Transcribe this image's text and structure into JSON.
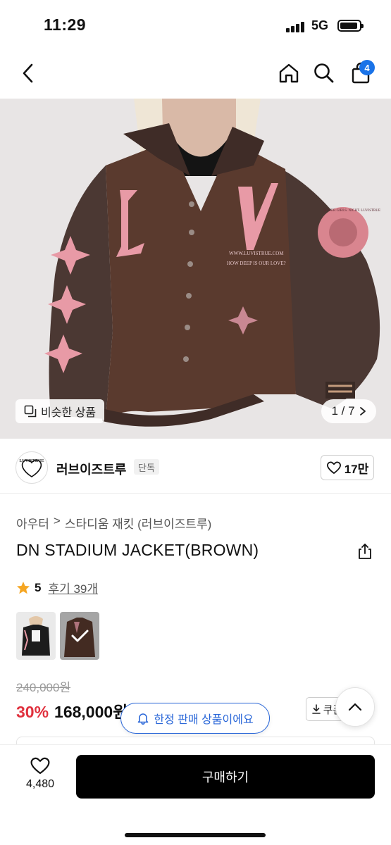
{
  "status_bar": {
    "time": "11:29",
    "network": "5G"
  },
  "nav": {
    "cart_count": "4"
  },
  "hero": {
    "similar_label": "비슷한 상품",
    "page_counter": "1 / 7",
    "image_texts": {
      "url": "WWW.LUVISTRUE.COM",
      "slogan": "HOW DEEP IS OUR LOVE?",
      "patch": "HYPER GIRLS. NIGHT. LUVISTRUE"
    }
  },
  "brand": {
    "logo_text": "LUVISTRUE",
    "name": "러브이즈트루",
    "tag": "단독",
    "likes": "17만"
  },
  "breadcrumb": {
    "category": "아우터",
    "separator": ">",
    "subcategory": "스타디움 재킷 (러브이즈트루)"
  },
  "product": {
    "title": "DN STADIUM JACKET(BROWN)",
    "rating": "5",
    "reviews_label": "후기 39개",
    "original_price": "240,000원",
    "discount": "30%",
    "price": "168,000원",
    "coupon_label": "쿠폰"
  },
  "limited_notice": "한정 판매 상품이에요",
  "bottom_bar": {
    "wish_count": "4,480",
    "buy_label": "구매하기"
  },
  "colors": {
    "accent_blue": "#2a67d8",
    "discount_red": "#e0303d",
    "badge_blue": "#1a73e8",
    "jacket_brown": "#5a3a2e",
    "pink": "#e89aa6"
  }
}
